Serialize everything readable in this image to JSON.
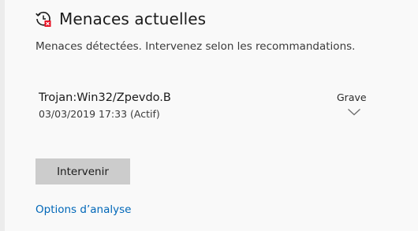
{
  "section": {
    "title": "Menaces actuelles",
    "icon": "history-threat-icon",
    "subtitle": "Menaces détectées. Intervenez selon les recommandations."
  },
  "threat": {
    "name": "Trojan:Win32/Zpevdo.B",
    "date_status": "03/03/2019 17:33 (Actif)",
    "severity": "Grave",
    "expand_icon": "chevron-down-icon"
  },
  "actions": {
    "take_action_label": "Intervenir",
    "scan_options_label": "Options d’analyse"
  },
  "colors": {
    "accent_link": "#0067b8",
    "alert_red": "#e81123",
    "button_bg": "#cccccc",
    "background": "#f9f9f9"
  }
}
